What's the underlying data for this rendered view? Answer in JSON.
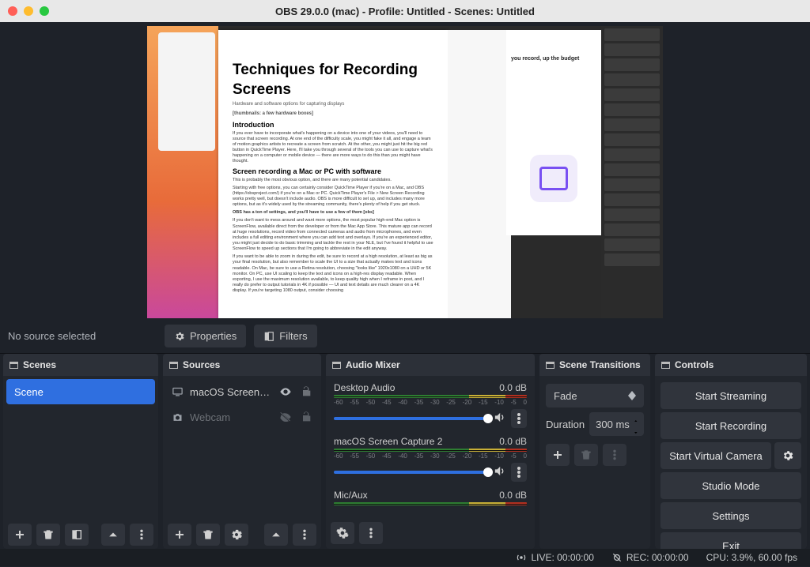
{
  "window": {
    "title": "OBS 29.0.0 (mac) - Profile: Untitled - Scenes: Untitled"
  },
  "context_bar": {
    "no_source": "No source selected",
    "properties": "Properties",
    "filters": "Filters"
  },
  "scenes": {
    "title": "Scenes",
    "items": [
      {
        "name": "Scene",
        "selected": true
      }
    ]
  },
  "sources": {
    "title": "Sources",
    "items": [
      {
        "name": "macOS Screen Capture",
        "icon": "display",
        "visible": true,
        "locked": false,
        "dim": false
      },
      {
        "name": "Webcam",
        "icon": "camera",
        "visible": false,
        "locked": false,
        "dim": true
      }
    ]
  },
  "mixer": {
    "title": "Audio Mixer",
    "ticks": [
      "-60",
      "-55",
      "-50",
      "-45",
      "-40",
      "-35",
      "-30",
      "-25",
      "-20",
      "-15",
      "-10",
      "-5",
      "0"
    ],
    "items": [
      {
        "name": "Desktop Audio",
        "db": "0.0 dB",
        "controls": true
      },
      {
        "name": "macOS Screen Capture 2",
        "db": "0.0 dB",
        "controls": true
      },
      {
        "name": "Mic/Aux",
        "db": "0.0 dB",
        "controls": false
      }
    ]
  },
  "transitions": {
    "title": "Scene Transitions",
    "selected": "Fade",
    "duration_label": "Duration",
    "duration_value": "300 ms"
  },
  "controls": {
    "title": "Controls",
    "start_streaming": "Start Streaming",
    "start_recording": "Start Recording",
    "start_vcam": "Start Virtual Camera",
    "studio_mode": "Studio Mode",
    "settings": "Settings",
    "exit": "Exit"
  },
  "status": {
    "live": "LIVE: 00:00:00",
    "rec": "REC: 00:00:00",
    "cpu": "CPU: 3.9%, 60.00 fps"
  },
  "preview_doc": {
    "h2a": "Techniques for Recording",
    "h2b": "Screens",
    "sub": "Hardware and software options for capturing displays",
    "thumbs": "[thumbnails: a few hardware boxes]",
    "intro_h": "Introduction",
    "intro_p1": "If you ever have to incorporate what's happening on a device into one of your videos, you'll need to source that screen recording. At one end of the difficulty scale, you might fake it all, and engage a team of motion graphics artists to recreate a screen from scratch. At the other, you might just hit the big red button in QuickTime Player. Here, I'll take you through several of the tools you can use to capture what's happening on a computer or mobile device — there are more ways to do this than you might have thought.",
    "srec_h": "Screen recording a Mac or PC with software",
    "srec_p1": "This is probably the most obvious option, and there are many potential candidates.",
    "srec_p2": "Starting with free options, you can certainly consider QuickTime Player if you're on a Mac, and OBS (https://obsproject.com/) if you're on a Mac or PC. QuickTime Player's File > New Screen Recording works pretty well, but doesn't include audio. OBS is more difficult to set up, and includes many more options, but as it's widely used by the streaming community, there's plenty of help if you get stuck.",
    "srec_p3b": "OBS has a ton of settings, and you'll have to use a few of them [obs]",
    "srec_p3": "If you don't want to mess around and want more options, the most popular high-end Mac option is ScreenFlow, available direct from the developer or from the Mac App Store. This mature app can record at huge resolutions, record video from connected cameras and audio from microphones, and even includes a full editing environment where you can add text and overlays. If you're an experienced editor, you might just decide to do basic trimming and tackle the rest in your NLE, but I've found it helpful to use ScreenFlow to speed up sections that I'm going to abbreviate in the edit anyway.",
    "srec_p4": "If you want to be able to zoom in during the edit, be sure to record at a high resolution, at least as big as your final resolution, but also remember to scale the UI to a size that actually makes text and icons readable. On Mac, be sure to use a Retina resolution, choosing \"looks like\" 1920x1080 on a UHD or 5K monitor. On PC, use UI scaling to keep the text and icons on a high-res display readable. When exporting, I use the maximum resolution available, to keep quality high when I reframe in post, and I really do prefer to output tutorials in 4K if possible — UI and text details are much clearer on a 4K display. If you're targeting 1080 output, consider choosing",
    "right_text": "you record, up the budget"
  }
}
